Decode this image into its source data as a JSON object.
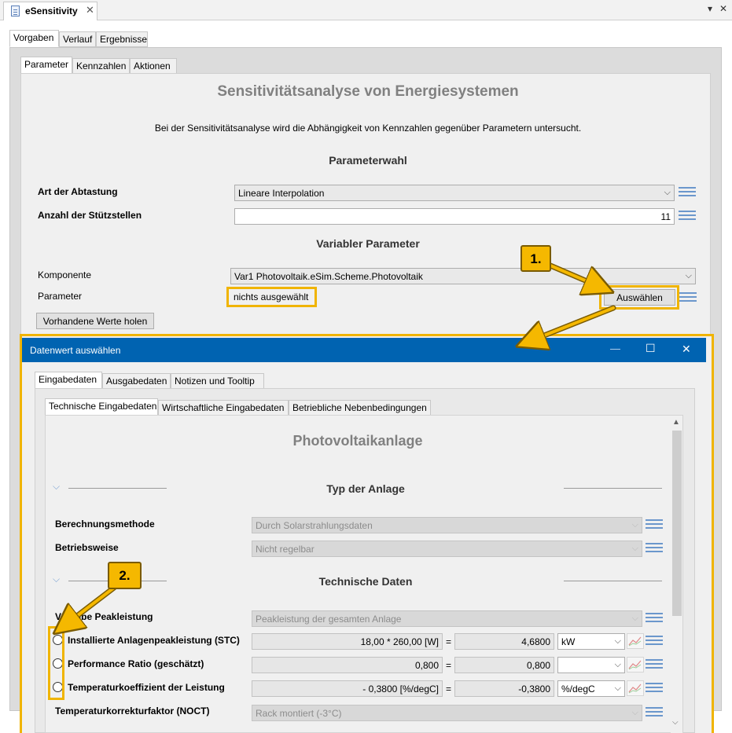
{
  "editor": {
    "tab_title": "eSensitivity",
    "close": "✕",
    "menu_arrow": "▾",
    "maximize": "✕"
  },
  "main_tabs": [
    {
      "label": "Vorgaben",
      "selected": true
    },
    {
      "label": "Verlauf",
      "selected": false
    },
    {
      "label": "Ergebnisse",
      "selected": false
    }
  ],
  "sub_tabs": [
    {
      "label": "Parameter",
      "selected": true
    },
    {
      "label": "Kennzahlen",
      "selected": false
    },
    {
      "label": "Aktionen",
      "selected": false
    }
  ],
  "page": {
    "title": "Sensitivitätsanalyse von Energiesystemen",
    "description": "Bei der Sensitivitätsanalyse wird die Abhängigkeit von Kennzahlen gegenüber Parametern untersucht.",
    "section_parameterwahl": "Parameterwahl",
    "art_label": "Art der Abtastung",
    "art_value": "Lineare Interpolation",
    "anzahl_label": "Anzahl der Stützstellen",
    "anzahl_value": "11",
    "section_variabler": "Variabler Parameter",
    "komponente_label": "Komponente",
    "komponente_value": "Var1 Photovoltaik.eSim.Scheme.Photovoltaik",
    "parameter_label": "Parameter",
    "parameter_value": "nichts ausgewählt",
    "auswaehlen_button": "Auswählen",
    "vorhandene_button": "Vorhandene Werte holen"
  },
  "callouts": {
    "one": "1.",
    "two": "2."
  },
  "dialog": {
    "title": "Datenwert auswählen",
    "minimize": "—",
    "maximize": "☐",
    "close": "✕",
    "tabs": [
      {
        "label": "Eingabedaten",
        "selected": true
      },
      {
        "label": "Ausgabedaten",
        "selected": false
      },
      {
        "label": "Notizen und Tooltip",
        "selected": false
      }
    ],
    "sub_tabs": [
      {
        "label": "Technische Eingabedaten",
        "selected": true
      },
      {
        "label": "Wirtschaftliche Eingabedaten",
        "selected": false
      },
      {
        "label": "Betriebliche Nebenbedingungen",
        "selected": false
      }
    ],
    "heading": "Photovoltaikanlage",
    "section_typ": "Typ der Anlage",
    "berechnung_label": "Berechnungsmethode",
    "berechnung_value": "Durch Solarstrahlungsdaten",
    "betrieb_label": "Betriebsweise",
    "betrieb_value": "Nicht regelbar",
    "section_tech": "Technische Daten",
    "vorgabe_label": "Vorgabe Peakleistung",
    "vorgabe_value": "Peakleistung der gesamten Anlage",
    "rows": [
      {
        "label": "Installierte Anlagenpeakleistung (STC)",
        "formula": "18,00 * 260,00 [W]",
        "eq": "=",
        "result": "4,6800",
        "unit": "kW"
      },
      {
        "label": "Performance Ratio (geschätzt)",
        "formula": "0,800",
        "eq": "=",
        "result": "0,800",
        "unit": ""
      },
      {
        "label": "Temperaturkoeffizient der Leistung",
        "formula": "- 0,3800 [%/degC]",
        "eq": "=",
        "result": "-0,3800",
        "unit": "%/degC"
      }
    ],
    "korrektur_label": "Temperaturkorrekturfaktor (NOCT)",
    "korrektur_value": "Rack montiert (-3°C)"
  },
  "colors": {
    "accent_title_bar": "#0063b1",
    "highlight": "#f0b400",
    "badge": "#f5b800"
  },
  "icons": [
    "document-icon",
    "close-icon",
    "chevron-down-icon",
    "list-icon",
    "chart-icon",
    "radio-icon",
    "scroll-up-icon",
    "scroll-down-icon"
  ]
}
